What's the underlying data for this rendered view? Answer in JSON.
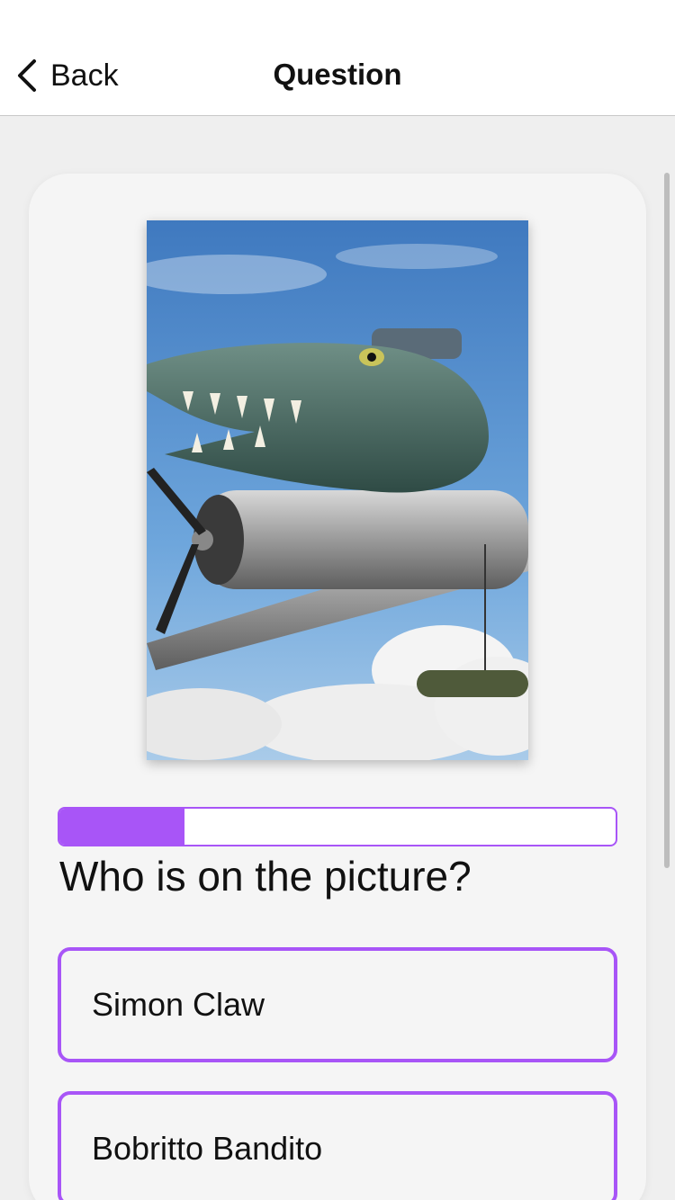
{
  "nav": {
    "back_label": "Back",
    "title": "Question"
  },
  "quiz": {
    "progress_fraction": 0.225,
    "question": "Who is on the picture?",
    "options": [
      "Simon Claw",
      "Bobritto Bandito"
    ]
  },
  "image": {
    "subject": "crocodile-headed warplane in sky"
  },
  "colors": {
    "accent": "#a855f7",
    "background": "#efefef",
    "card": "#f5f5f5"
  }
}
